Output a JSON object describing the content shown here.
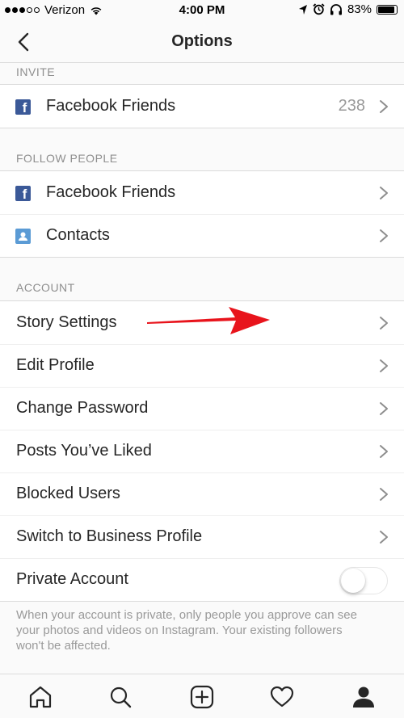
{
  "status_bar": {
    "carrier": "Verizon",
    "time": "4:00 PM",
    "battery": "83%",
    "signal_bars_filled": 3,
    "signal_bars_total": 5
  },
  "nav": {
    "title": "Options",
    "back_icon": "chevron-left-icon"
  },
  "sections": {
    "invite": {
      "header": "INVITE",
      "items": [
        {
          "label": "Facebook Friends",
          "count": "238",
          "icon": "facebook-icon"
        }
      ]
    },
    "follow_people": {
      "header": "FOLLOW PEOPLE",
      "items": [
        {
          "label": "Facebook Friends",
          "icon": "facebook-icon"
        },
        {
          "label": "Contacts",
          "icon": "contacts-icon"
        }
      ]
    },
    "account": {
      "header": "ACCOUNT",
      "items": [
        {
          "label": "Story Settings"
        },
        {
          "label": "Edit Profile"
        },
        {
          "label": "Change Password"
        },
        {
          "label": "Posts You’ve Liked"
        },
        {
          "label": "Blocked Users"
        },
        {
          "label": "Switch to Business Profile"
        },
        {
          "label": "Private Account",
          "toggle": false
        }
      ],
      "note": "When your account is private, only people you approve can see your photos and videos on Instagram. Your existing followers won't be affected."
    }
  },
  "tabbar": {
    "tabs": [
      {
        "name": "home",
        "icon": "home-icon"
      },
      {
        "name": "search",
        "icon": "search-icon"
      },
      {
        "name": "new-post",
        "icon": "add-post-icon"
      },
      {
        "name": "activity",
        "icon": "heart-icon"
      },
      {
        "name": "profile",
        "icon": "profile-icon",
        "active": true
      }
    ]
  },
  "colors": {
    "background": "#fafafa",
    "row_background": "#ffffff",
    "divider": "#dbdbdb",
    "text": "#262626",
    "secondary_text": "#8e8e8e",
    "facebook_blue": "#3b5998",
    "contacts_blue": "#5b9bd5",
    "annotation_arrow": "#e8141c"
  }
}
